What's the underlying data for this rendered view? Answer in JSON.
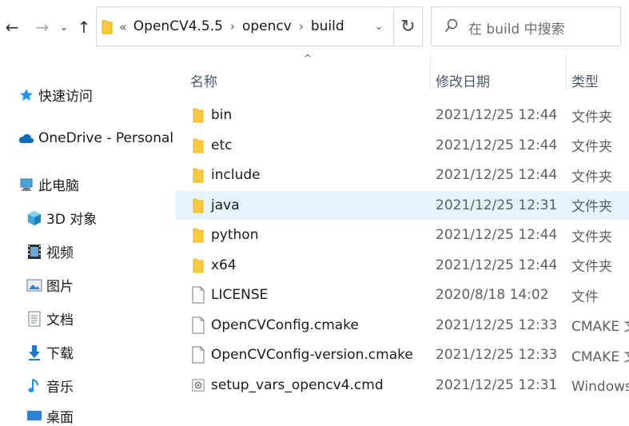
{
  "toolbar": {
    "address": {
      "crumbs": [
        "OpenCV4.5.5",
        "opencv",
        "build"
      ],
      "overflow": "«"
    },
    "search": {
      "placeholder": "在 build 中搜索"
    }
  },
  "nav": {
    "quick_access": "快速访问",
    "onedrive": "OneDrive - Personal",
    "this_pc": "此电脑",
    "items": [
      {
        "label": "3D 对象",
        "icon": "3d-objects-icon"
      },
      {
        "label": "视频",
        "icon": "videos-icon"
      },
      {
        "label": "图片",
        "icon": "pictures-icon"
      },
      {
        "label": "文档",
        "icon": "documents-icon"
      },
      {
        "label": "下载",
        "icon": "downloads-icon"
      },
      {
        "label": "音乐",
        "icon": "music-icon"
      },
      {
        "label": "桌面",
        "icon": "desktop-icon"
      }
    ]
  },
  "columns": {
    "name": "名称",
    "date": "修改日期",
    "type": "类型"
  },
  "files": [
    {
      "name": "bin",
      "date": "2021/12/25 12:44",
      "type": "文件夹",
      "kind": "folder"
    },
    {
      "name": "etc",
      "date": "2021/12/25 12:44",
      "type": "文件夹",
      "kind": "folder"
    },
    {
      "name": "include",
      "date": "2021/12/25 12:44",
      "type": "文件夹",
      "kind": "folder"
    },
    {
      "name": "java",
      "date": "2021/12/25 12:31",
      "type": "文件夹",
      "kind": "folder",
      "selected": true
    },
    {
      "name": "python",
      "date": "2021/12/25 12:44",
      "type": "文件夹",
      "kind": "folder"
    },
    {
      "name": "x64",
      "date": "2021/12/25 12:44",
      "type": "文件夹",
      "kind": "folder"
    },
    {
      "name": "LICENSE",
      "date": "2020/8/18 14:02",
      "type": "文件",
      "kind": "file"
    },
    {
      "name": "OpenCVConfig.cmake",
      "date": "2021/12/25 12:33",
      "type": "CMAKE 文件",
      "kind": "file"
    },
    {
      "name": "OpenCVConfig-version.cmake",
      "date": "2021/12/25 12:33",
      "type": "CMAKE 文件",
      "kind": "file"
    },
    {
      "name": "setup_vars_opencv4.cmd",
      "date": "2021/12/25 12:31",
      "type": "Windows 命令脚本",
      "kind": "cmd"
    }
  ],
  "colors": {
    "folder": "#ffc83d",
    "selected_row": "#e5f3ff",
    "accent": "#0078d4"
  }
}
